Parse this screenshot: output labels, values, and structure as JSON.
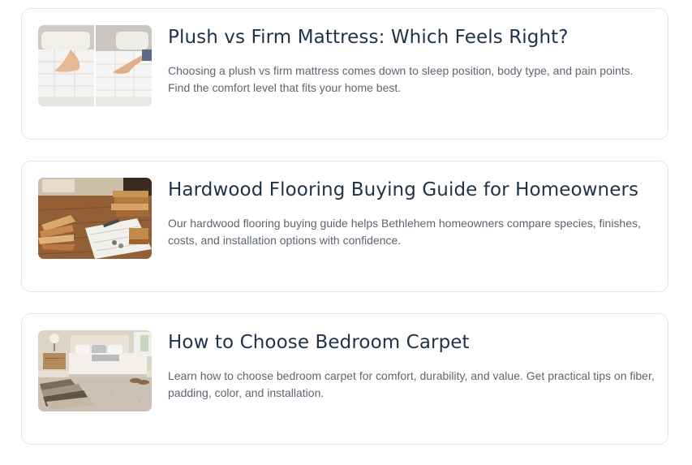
{
  "posts": [
    {
      "title": "Plush vs Firm Mattress: Which Feels Right?",
      "excerpt": "Choosing a plush vs firm mattress comes down to sleep position, body type, and pain points. Find the comfort level that fits your home best.",
      "thumbnail_icon": "mattress-comparison-image"
    },
    {
      "title": "Hardwood Flooring Buying Guide for Homeowners",
      "excerpt": "Our hardwood flooring buying guide helps Bethlehem homeowners compare species, finishes, costs, and installation options with confidence.",
      "thumbnail_icon": "hardwood-planks-image"
    },
    {
      "title": "How to Choose Bedroom Carpet",
      "excerpt": "Learn how to choose bedroom carpet for comfort, durability, and value. Get practical tips on fiber, padding, color, and installation.",
      "thumbnail_icon": "bedroom-carpet-image"
    }
  ],
  "colors": {
    "title": "#1f3348",
    "excerpt": "#5c6670",
    "card_border": "#e3e6ea"
  }
}
